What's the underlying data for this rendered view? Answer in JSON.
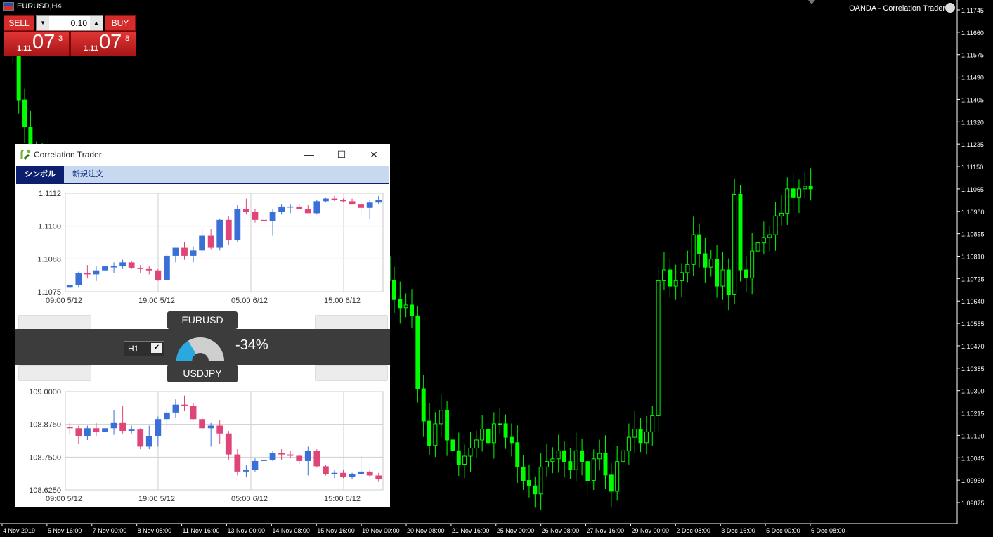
{
  "window": {
    "title": "EURUSD,H4",
    "broker": "OANDA - Correlation Trader"
  },
  "trade_panel": {
    "sell_label": "SELL",
    "buy_label": "BUY",
    "lot": "0.10",
    "sell_price": {
      "prefix": "1.11",
      "big": "07",
      "sup": "3"
    },
    "buy_price": {
      "prefix": "1.11",
      "big": "07",
      "sup": "8"
    }
  },
  "correlation_window": {
    "title": "Correlation Trader",
    "tabs": [
      "シンボル",
      "新規注文"
    ],
    "symbol_a": "EURUSD",
    "symbol_b": "USDJPY",
    "timeframe": "H1",
    "correlation": "-34%",
    "gauge_fraction": 0.33
  },
  "colors": {
    "bull_main": "#00ff00",
    "bear_main": "#000000",
    "mini_bull": "#3a6fd8",
    "mini_bear": "#e0457a",
    "tab_active": "#0c1f6e"
  },
  "chart_data": [
    {
      "type": "candlestick",
      "name": "main",
      "price_axis": [
        "1.11745",
        "1.11660",
        "1.11575",
        "1.11490",
        "1.11405",
        "1.11320",
        "1.11235",
        "1.11150",
        "1.11065",
        "1.10980",
        "1.10895",
        "1.10810",
        "1.10725",
        "1.10640",
        "1.10555",
        "1.10470",
        "1.10385",
        "1.10300",
        "1.10215",
        "1.10130",
        "1.10045",
        "1.09960",
        "1.09875"
      ],
      "time_axis": [
        "4 Nov 2019",
        "5 Nov 16:00",
        "7 Nov 00:00",
        "8 Nov 08:00",
        "11 Nov 16:00",
        "13 Nov 00:00",
        "14 Nov 08:00",
        "15 Nov 16:00",
        "19 Nov 00:00",
        "20 Nov 08:00",
        "21 Nov 16:00",
        "25 Nov 00:00",
        "26 Nov 08:00",
        "27 Nov 16:00",
        "29 Nov 00:00",
        "2 Dec 08:00",
        "3 Dec 16:00",
        "5 Dec 00:00",
        "6 Dec 08:00"
      ],
      "ylim": [
        1.0984,
        1.1178
      ],
      "close": [
        1.1164,
        1.1159,
        1.1141,
        1.1131,
        1.1122,
        1.1118,
        1.112,
        1.1116,
        1.1112,
        1.1106,
        1.1098,
        1.109,
        1.1082,
        1.1075,
        1.107,
        1.1067,
        1.1071,
        1.1066,
        1.1072,
        1.1068,
        1.1063,
        1.107,
        1.1066,
        1.1073,
        1.1078,
        1.1074,
        1.108,
        1.1077,
        1.1082,
        1.1086,
        1.1078,
        1.1076,
        1.1073,
        1.107,
        1.1068,
        1.1066,
        1.107,
        1.1069,
        1.1072,
        1.1076,
        1.1079,
        1.1073,
        1.1067,
        1.1062,
        1.1064,
        1.1071,
        1.1072,
        1.1066,
        1.1058,
        1.1055,
        1.1051,
        1.1046,
        1.105,
        1.1056,
        1.1064,
        1.1069,
        1.1074,
        1.1071,
        1.1066,
        1.1069,
        1.1073,
        1.108,
        1.1086,
        1.1082,
        1.1083,
        1.1074,
        1.1067,
        1.1064,
        1.1065,
        1.1061,
        1.1034,
        1.1022,
        1.1013,
        1.1021,
        1.1026,
        1.1015,
        1.1011,
        1.1006,
        1.1009,
        1.1012,
        1.1015,
        1.1019,
        1.1014,
        1.1021,
        1.1021,
        1.1016,
        1.1014,
        1.1005,
        1.1,
        1.0998,
        1.0995,
        1.1005,
        1.1007,
        1.1008,
        1.1011,
        1.1007,
        1.1004,
        1.1011,
        1.1007,
        1.1,
        1.1008,
        1.101,
        1.1002,
        1.0996,
        1.1007,
        1.1011,
        1.1016,
        1.1019,
        1.1014,
        1.1018,
        1.1024,
        1.1074,
        1.1078,
        1.1072,
        1.1074,
        1.1077,
        1.108,
        1.1091,
        1.1084,
        1.1079,
        1.1082,
        1.1072,
        1.1078,
        1.1069,
        1.1106,
        1.1078,
        1.1075,
        1.1085,
        1.1088,
        1.109,
        1.1091,
        1.1098,
        1.1099,
        1.1108,
        1.1105,
        1.1108,
        1.1109,
        1.1108
      ]
    },
    {
      "type": "candlestick",
      "name": "EURUSD",
      "yticks": [
        "1.1112",
        "1.1100",
        "1.1088",
        "1.1075"
      ],
      "xticks": [
        "09:00 5/12",
        "19:00 5/12",
        "05:00 6/12",
        "15:00 6/12"
      ],
      "ylim": [
        1.1075,
        1.1112
      ],
      "candles": [
        [
          1.10765,
          1.10775,
          1.10765,
          1.10775
        ],
        [
          1.10775,
          1.10825,
          1.10765,
          1.1082
        ],
        [
          1.1082,
          1.1085,
          1.108,
          1.10815
        ],
        [
          1.10815,
          1.10845,
          1.1079,
          1.1083
        ],
        [
          1.1083,
          1.10845,
          1.1081,
          1.10845
        ],
        [
          1.10845,
          1.1086,
          1.1082,
          1.10845
        ],
        [
          1.10845,
          1.1087,
          1.10835,
          1.1086
        ],
        [
          1.1086,
          1.10865,
          1.10835,
          1.1084
        ],
        [
          1.1084,
          1.1085,
          1.1082,
          1.10835
        ],
        [
          1.10835,
          1.10845,
          1.10815,
          1.1083
        ],
        [
          1.1083,
          1.10835,
          1.1079,
          1.10795
        ],
        [
          1.10795,
          1.10895,
          1.1079,
          1.10885
        ],
        [
          1.10885,
          1.10915,
          1.1086,
          1.10915
        ],
        [
          1.10915,
          1.10935,
          1.1087,
          1.10885
        ],
        [
          1.10885,
          1.1092,
          1.1086,
          1.10905
        ],
        [
          1.10905,
          1.10985,
          1.109,
          1.1096
        ],
        [
          1.1096,
          1.10985,
          1.1091,
          1.10915
        ],
        [
          1.10915,
          1.11025,
          1.10905,
          1.1102
        ],
        [
          1.1102,
          1.11035,
          1.10925,
          1.10945
        ],
        [
          1.10945,
          1.11075,
          1.10935,
          1.1106
        ],
        [
          1.1106,
          1.111,
          1.1104,
          1.1105
        ],
        [
          1.1105,
          1.1106,
          1.1101,
          1.1102
        ],
        [
          1.1102,
          1.1104,
          1.1098,
          1.11015
        ],
        [
          1.11015,
          1.1106,
          1.1096,
          1.1105
        ],
        [
          1.1105,
          1.1108,
          1.1104,
          1.1107
        ],
        [
          1.1107,
          1.1108,
          1.11045,
          1.1107
        ],
        [
          1.1107,
          1.1108,
          1.1106,
          1.1106
        ],
        [
          1.1106,
          1.11075,
          1.1105,
          1.11045
        ],
        [
          1.11045,
          1.11095,
          1.1104,
          1.1109
        ],
        [
          1.1109,
          1.11105,
          1.11085,
          1.111
        ],
        [
          1.111,
          1.1111,
          1.1109,
          1.11095
        ],
        [
          1.11095,
          1.111,
          1.11085,
          1.1109
        ],
        [
          1.1109,
          1.111,
          1.1108,
          1.1108
        ],
        [
          1.1108,
          1.1109,
          1.11045,
          1.11065
        ],
        [
          1.11065,
          1.11095,
          1.11025,
          1.11085
        ],
        [
          1.11085,
          1.1111,
          1.1108,
          1.11095
        ]
      ]
    },
    {
      "type": "candlestick",
      "name": "USDJPY",
      "yticks": [
        "109.0000",
        "108.8750",
        "108.7500",
        "108.6250"
      ],
      "xticks": [
        "09:00 5/12",
        "19:00 5/12",
        "05:00 6/12",
        "15:00 6/12"
      ],
      "ylim": [
        108.625,
        109.0
      ],
      "candles": [
        [
          108.865,
          108.88,
          108.835,
          108.86
        ],
        [
          108.86,
          108.87,
          108.8,
          108.83
        ],
        [
          108.83,
          108.87,
          108.815,
          108.86
        ],
        [
          108.86,
          108.88,
          108.83,
          108.845
        ],
        [
          108.845,
          108.945,
          108.805,
          108.86
        ],
        [
          108.86,
          108.93,
          108.835,
          108.88
        ],
        [
          108.88,
          108.945,
          108.84,
          108.85
        ],
        [
          108.85,
          108.87,
          108.84,
          108.855
        ],
        [
          108.855,
          108.86,
          108.78,
          108.79
        ],
        [
          108.79,
          108.87,
          108.78,
          108.83
        ],
        [
          108.83,
          108.905,
          108.79,
          108.895
        ],
        [
          108.895,
          108.94,
          108.86,
          108.92
        ],
        [
          108.92,
          108.97,
          108.9,
          108.95
        ],
        [
          108.95,
          108.985,
          108.925,
          108.945
        ],
        [
          108.945,
          108.955,
          108.89,
          108.895
        ],
        [
          108.895,
          108.905,
          108.85,
          108.86
        ],
        [
          108.86,
          108.88,
          108.79,
          108.87
        ],
        [
          108.87,
          108.89,
          108.8,
          108.84
        ],
        [
          108.84,
          108.85,
          108.74,
          108.76
        ],
        [
          108.76,
          108.78,
          108.68,
          108.695
        ],
        [
          108.695,
          108.72,
          108.675,
          108.7
        ],
        [
          108.7,
          108.745,
          108.695,
          108.735
        ],
        [
          108.735,
          108.745,
          108.68,
          108.74
        ],
        [
          108.74,
          108.775,
          108.735,
          108.765
        ],
        [
          108.765,
          108.78,
          108.74,
          108.76
        ],
        [
          108.76,
          108.775,
          108.745,
          108.755
        ],
        [
          108.755,
          108.76,
          108.725,
          108.735
        ],
        [
          108.735,
          108.79,
          108.68,
          108.775
        ],
        [
          108.775,
          108.78,
          108.71,
          108.715
        ],
        [
          108.715,
          108.72,
          108.68,
          108.685
        ],
        [
          108.685,
          108.7,
          108.67,
          108.69
        ],
        [
          108.69,
          108.7,
          108.67,
          108.675
        ],
        [
          108.675,
          108.69,
          108.665,
          108.685
        ],
        [
          108.685,
          108.755,
          108.67,
          108.695
        ],
        [
          108.695,
          108.7,
          108.675,
          108.68
        ],
        [
          108.68,
          108.69,
          108.655,
          108.665
        ]
      ]
    }
  ]
}
